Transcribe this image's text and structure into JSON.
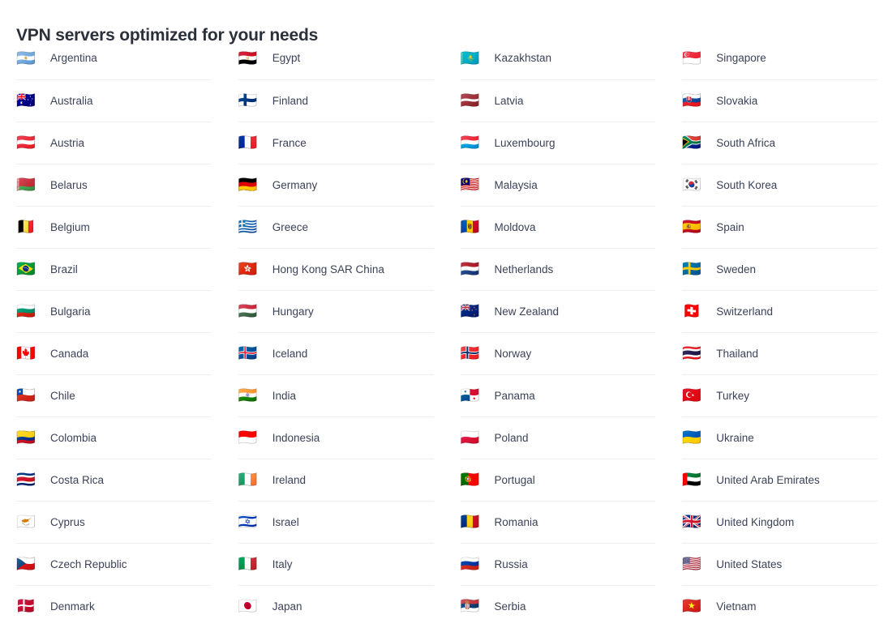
{
  "header": {
    "title": "VPN servers optimized for your needs"
  },
  "theme": {
    "background": "#ffffff",
    "title_color": "#2b303b",
    "text_color": "#3c4257",
    "divider_color": "#edeff2"
  },
  "columns": [
    {
      "id": "column-1",
      "items": [
        {
          "name": "Argentina",
          "flag": "🇦🇷",
          "icon": "flag-argentina-icon"
        },
        {
          "name": "Australia",
          "flag": "🇦🇺",
          "icon": "flag-australia-icon"
        },
        {
          "name": "Austria",
          "flag": "🇦🇹",
          "icon": "flag-austria-icon"
        },
        {
          "name": "Belarus",
          "flag": "🇧🇾",
          "icon": "flag-belarus-icon"
        },
        {
          "name": "Belgium",
          "flag": "🇧🇪",
          "icon": "flag-belgium-icon"
        },
        {
          "name": "Brazil",
          "flag": "🇧🇷",
          "icon": "flag-brazil-icon"
        },
        {
          "name": "Bulgaria",
          "flag": "🇧🇬",
          "icon": "flag-bulgaria-icon"
        },
        {
          "name": "Canada",
          "flag": "🇨🇦",
          "icon": "flag-canada-icon"
        },
        {
          "name": "Chile",
          "flag": "🇨🇱",
          "icon": "flag-chile-icon"
        },
        {
          "name": "Colombia",
          "flag": "🇨🇴",
          "icon": "flag-colombia-icon"
        },
        {
          "name": "Costa Rica",
          "flag": "🇨🇷",
          "icon": "flag-costa-rica-icon"
        },
        {
          "name": "Cyprus",
          "flag": "🇨🇾",
          "icon": "flag-cyprus-icon"
        },
        {
          "name": "Czech Republic",
          "flag": "🇨🇿",
          "icon": "flag-czech-republic-icon"
        },
        {
          "name": "Denmark",
          "flag": "🇩🇰",
          "icon": "flag-denmark-icon"
        }
      ]
    },
    {
      "id": "column-2",
      "items": [
        {
          "name": "Egypt",
          "flag": "🇪🇬",
          "icon": "flag-egypt-icon"
        },
        {
          "name": "Finland",
          "flag": "🇫🇮",
          "icon": "flag-finland-icon"
        },
        {
          "name": "France",
          "flag": "🇫🇷",
          "icon": "flag-france-icon"
        },
        {
          "name": "Germany",
          "flag": "🇩🇪",
          "icon": "flag-germany-icon"
        },
        {
          "name": "Greece",
          "flag": "🇬🇷",
          "icon": "flag-greece-icon"
        },
        {
          "name": "Hong Kong SAR China",
          "flag": "🇭🇰",
          "icon": "flag-hong-kong-icon"
        },
        {
          "name": "Hungary",
          "flag": "🇭🇺",
          "icon": "flag-hungary-icon"
        },
        {
          "name": "Iceland",
          "flag": "🇮🇸",
          "icon": "flag-iceland-icon"
        },
        {
          "name": "India",
          "flag": "🇮🇳",
          "icon": "flag-india-icon"
        },
        {
          "name": "Indonesia",
          "flag": "🇮🇩",
          "icon": "flag-indonesia-icon"
        },
        {
          "name": "Ireland",
          "flag": "🇮🇪",
          "icon": "flag-ireland-icon"
        },
        {
          "name": "Israel",
          "flag": "🇮🇱",
          "icon": "flag-israel-icon"
        },
        {
          "name": "Italy",
          "flag": "🇮🇹",
          "icon": "flag-italy-icon"
        },
        {
          "name": "Japan",
          "flag": "🇯🇵",
          "icon": "flag-japan-icon"
        }
      ]
    },
    {
      "id": "column-3",
      "items": [
        {
          "name": "Kazakhstan",
          "flag": "🇰🇿",
          "icon": "flag-kazakhstan-icon"
        },
        {
          "name": "Latvia",
          "flag": "🇱🇻",
          "icon": "flag-latvia-icon"
        },
        {
          "name": "Luxembourg",
          "flag": "🇱🇺",
          "icon": "flag-luxembourg-icon"
        },
        {
          "name": "Malaysia",
          "flag": "🇲🇾",
          "icon": "flag-malaysia-icon"
        },
        {
          "name": "Moldova",
          "flag": "🇲🇩",
          "icon": "flag-moldova-icon"
        },
        {
          "name": "Netherlands",
          "flag": "🇳🇱",
          "icon": "flag-netherlands-icon"
        },
        {
          "name": "New Zealand",
          "flag": "🇳🇿",
          "icon": "flag-new-zealand-icon"
        },
        {
          "name": "Norway",
          "flag": "🇳🇴",
          "icon": "flag-norway-icon"
        },
        {
          "name": "Panama",
          "flag": "🇵🇦",
          "icon": "flag-panama-icon"
        },
        {
          "name": "Poland",
          "flag": "🇵🇱",
          "icon": "flag-poland-icon"
        },
        {
          "name": "Portugal",
          "flag": "🇵🇹",
          "icon": "flag-portugal-icon"
        },
        {
          "name": "Romania",
          "flag": "🇷🇴",
          "icon": "flag-romania-icon"
        },
        {
          "name": "Russia",
          "flag": "🇷🇺",
          "icon": "flag-russia-icon"
        },
        {
          "name": "Serbia",
          "flag": "🇷🇸",
          "icon": "flag-serbia-icon"
        }
      ]
    },
    {
      "id": "column-4",
      "items": [
        {
          "name": "Singapore",
          "flag": "🇸🇬",
          "icon": "flag-singapore-icon"
        },
        {
          "name": "Slovakia",
          "flag": "🇸🇰",
          "icon": "flag-slovakia-icon"
        },
        {
          "name": "South Africa",
          "flag": "🇿🇦",
          "icon": "flag-south-africa-icon"
        },
        {
          "name": "South Korea",
          "flag": "🇰🇷",
          "icon": "flag-south-korea-icon"
        },
        {
          "name": "Spain",
          "flag": "🇪🇸",
          "icon": "flag-spain-icon"
        },
        {
          "name": "Sweden",
          "flag": "🇸🇪",
          "icon": "flag-sweden-icon"
        },
        {
          "name": "Switzerland",
          "flag": "🇨🇭",
          "icon": "flag-switzerland-icon"
        },
        {
          "name": "Thailand",
          "flag": "🇹🇭",
          "icon": "flag-thailand-icon"
        },
        {
          "name": "Turkey",
          "flag": "🇹🇷",
          "icon": "flag-turkey-icon"
        },
        {
          "name": "Ukraine",
          "flag": "🇺🇦",
          "icon": "flag-ukraine-icon"
        },
        {
          "name": "United Arab Emirates",
          "flag": "🇦🇪",
          "icon": "flag-united-arab-emirates-icon"
        },
        {
          "name": "United Kingdom",
          "flag": "🇬🇧",
          "icon": "flag-united-kingdom-icon"
        },
        {
          "name": "United States",
          "flag": "🇺🇸",
          "icon": "flag-united-states-icon"
        },
        {
          "name": "Vietnam",
          "flag": "🇻🇳",
          "icon": "flag-vietnam-icon"
        }
      ]
    }
  ]
}
